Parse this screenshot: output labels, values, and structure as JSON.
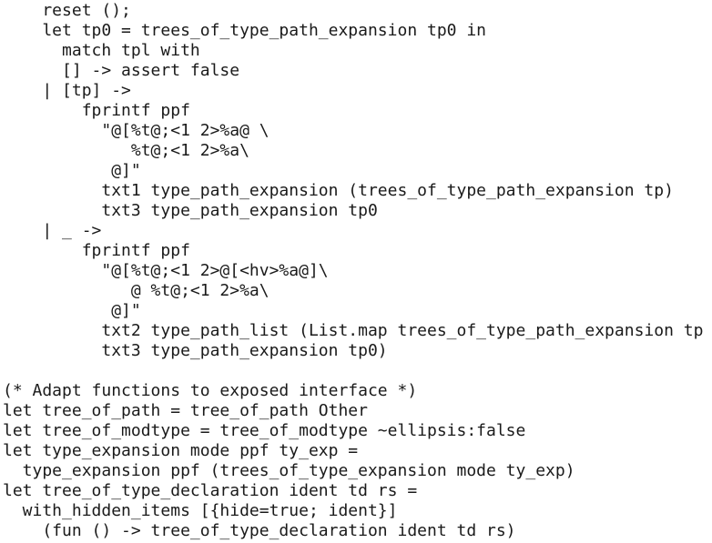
{
  "editor": {
    "background": "#ffffff",
    "text_color": "#1a1a1a",
    "lines": [
      "    reset ();",
      "    let tp0 = trees_of_type_path_expansion tp0 in",
      "      match tpl with",
      "      [] -> assert false",
      "    | [tp] ->",
      "        fprintf ppf",
      "          \"@[%t@;<1 2>%a@ \\",
      "             %t@;<1 2>%a\\",
      "           @]\"",
      "          txt1 type_path_expansion (trees_of_type_path_expansion tp)",
      "          txt3 type_path_expansion tp0",
      "    | _ ->",
      "        fprintf ppf",
      "          \"@[%t@;<1 2>@[<hv>%a@]\\",
      "             @ %t@;<1 2>%a\\",
      "           @]\"",
      "          txt2 type_path_list (List.map trees_of_type_path_expansion tp",
      "          txt3 type_path_expansion tp0)",
      "",
      "(* Adapt functions to exposed interface *)",
      "let tree_of_path = tree_of_path Other",
      "let tree_of_modtype = tree_of_modtype ~ellipsis:false",
      "let type_expansion mode ppf ty_exp =",
      "  type_expansion ppf (trees_of_type_expansion mode ty_exp)",
      "let tree_of_type_declaration ident td rs =",
      "  with_hidden_items [{hide=true; ident}]",
      "    (fun () -> tree_of_type_declaration ident td rs)"
    ]
  }
}
